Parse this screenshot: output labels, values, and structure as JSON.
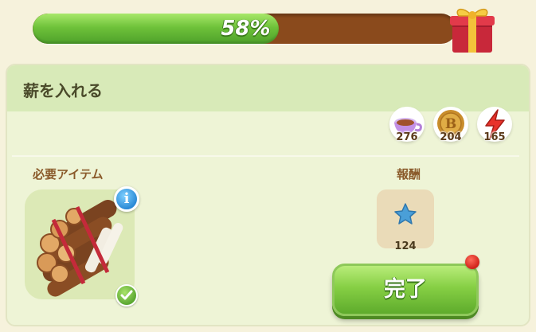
{
  "progress": {
    "label": "58%",
    "fraction": 0.58
  },
  "panel": {
    "title": "薪を入れる"
  },
  "currencies": [
    {
      "name": "tea-cup-icon",
      "count": "276"
    },
    {
      "name": "coin-icon",
      "count": "204"
    },
    {
      "name": "energy-icon",
      "count": "165"
    }
  ],
  "required": {
    "label": "必要アイテム",
    "item_icon": "firewood-bundle-icon"
  },
  "reward": {
    "label": "報酬",
    "icon": "blue-star-icon",
    "count": "124"
  },
  "complete_button": {
    "label": "完了"
  },
  "colors": {
    "progress_fill": "#6fc23a",
    "progress_track": "#8a4a1c",
    "panel_bg": "#eef4d6",
    "header_bg": "#d8eab8",
    "button_green": "#86cf44"
  }
}
